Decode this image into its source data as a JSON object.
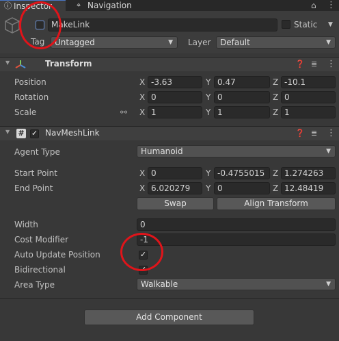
{
  "tabs": [
    {
      "label": "Inspector",
      "icon": "info-icon"
    },
    {
      "label": "Navigation",
      "icon": "navigation-icon"
    }
  ],
  "header": {
    "object_name": "MakeLink",
    "static_label": "Static",
    "tag_label": "Tag",
    "tag_value": "Untagged",
    "layer_label": "Layer",
    "layer_value": "Default"
  },
  "transform": {
    "title": "Transform",
    "rows": [
      {
        "label": "Position",
        "x": "-3.63",
        "y": "0.47",
        "z": "-10.1"
      },
      {
        "label": "Rotation",
        "x": "0",
        "y": "0",
        "z": "0"
      },
      {
        "label": "Scale",
        "x": "1",
        "y": "1",
        "z": "1"
      }
    ]
  },
  "navmeshlink": {
    "title": "NavMeshLink",
    "agent_type_label": "Agent Type",
    "agent_type_value": "Humanoid",
    "start_label": "Start Point",
    "start": {
      "x": "0",
      "y": "-0.4755015",
      "z": "1.274263"
    },
    "end_label": "End Point",
    "end": {
      "x": "6.020279",
      "y": "0",
      "z": "12.48419"
    },
    "swap_label": "Swap",
    "align_label": "Align Transform",
    "width_label": "Width",
    "width_value": "0",
    "cost_label": "Cost Modifier",
    "cost_value": "-1",
    "auto_update_label": "Auto Update Position",
    "auto_update": true,
    "bidirectional_label": "Bidirectional",
    "bidirectional": true,
    "area_type_label": "Area Type",
    "area_type_value": "Walkable"
  },
  "axes": {
    "x": "X",
    "y": "Y",
    "z": "Z"
  },
  "add_component_label": "Add Component",
  "highlight_color": "#e0141a"
}
